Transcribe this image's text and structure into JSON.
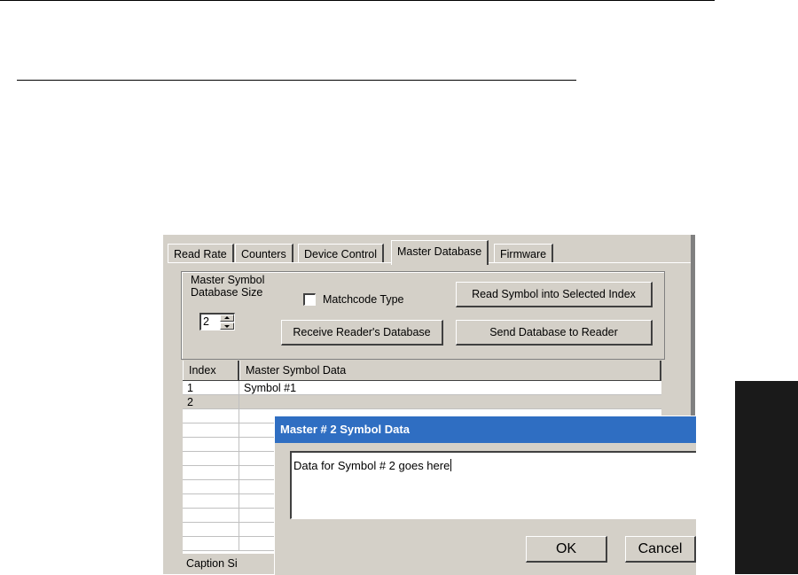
{
  "tabs": [
    "Read Rate",
    "Counters",
    "Device Control",
    "Master Database",
    "Firmware"
  ],
  "master_db": {
    "size_label_1": "Master Symbol",
    "size_label_2": "Database Size",
    "size_value": "2",
    "matchcode_label": "Matchcode Type",
    "read_symbol_button": "Read Symbol into Selected Index",
    "receive_button": "Receive Reader's Database",
    "send_button": "Send Database to Reader"
  },
  "grid": {
    "headers": [
      "Index",
      "Master Symbol Data"
    ],
    "rows": [
      {
        "index": "1",
        "data": "Symbol #1"
      },
      {
        "index": "2",
        "data": ""
      }
    ]
  },
  "caption_stub": "Caption Si",
  "dialog": {
    "title": "Master # 2 Symbol Data",
    "input_value": "Data for Symbol # 2 goes here",
    "ok_label": "OK",
    "cancel_label": "Cancel"
  },
  "colors": {
    "title_bar": "#2f6ec2",
    "window_face": "#d4d0c8",
    "side_tab": "#1a1a1a"
  }
}
